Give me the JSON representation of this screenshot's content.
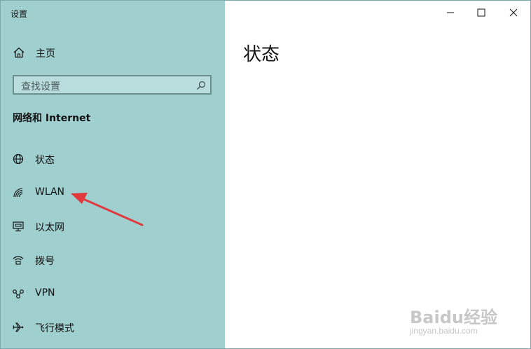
{
  "window": {
    "title": "设置"
  },
  "sidebar": {
    "home_label": "主页",
    "search_placeholder": "查找设置",
    "section_title": "网络和 Internet",
    "items": [
      {
        "label": "状态",
        "icon": "globe-icon"
      },
      {
        "label": "WLAN",
        "icon": "wifi-icon"
      },
      {
        "label": "以太网",
        "icon": "ethernet-icon"
      },
      {
        "label": "拨号",
        "icon": "dialup-icon"
      },
      {
        "label": "VPN",
        "icon": "vpn-icon"
      },
      {
        "label": "飞行模式",
        "icon": "airplane-icon"
      }
    ]
  },
  "main": {
    "page_title": "状态"
  },
  "watermark": {
    "brand": "Baidu经验",
    "url": "jingyan.baidu.com"
  },
  "colors": {
    "sidebar_bg": "#a0cfd0",
    "arrow": "#e0393e",
    "content_bg": "#ffffff"
  }
}
